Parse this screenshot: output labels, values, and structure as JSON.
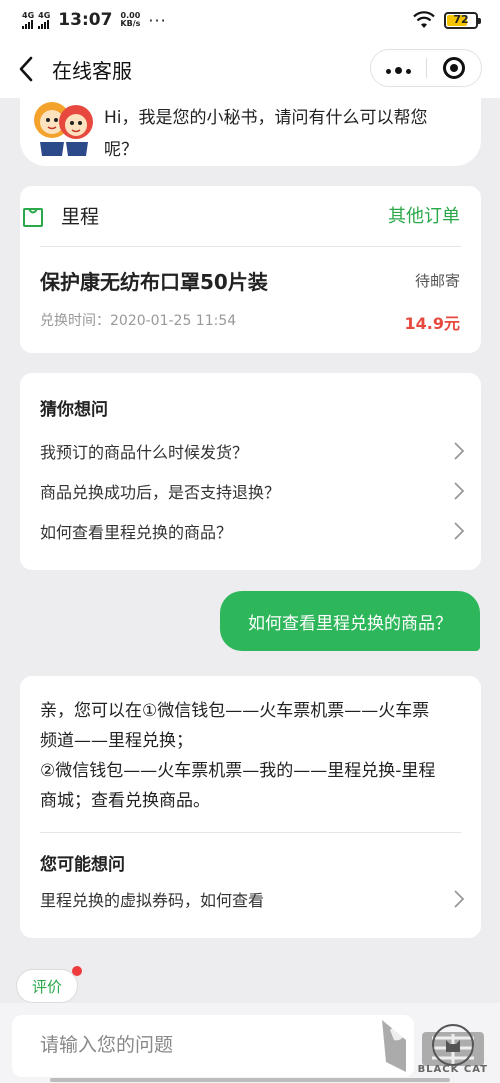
{
  "status_bar": {
    "signal_1": "4G",
    "signal_2": "4G",
    "time": "13:07",
    "net_speed_value": "0.00",
    "net_speed_unit": "KB/s",
    "dots": "···",
    "battery_level": "72",
    "battery_color": "#f5c400"
  },
  "nav": {
    "title": "在线客服",
    "icons": [
      "back-icon",
      "more-icon",
      "target-icon"
    ]
  },
  "bot_greeting": {
    "text": "Hi，我是您的小秘书，请问有什么可以帮您呢？"
  },
  "order_card": {
    "brand": "里程",
    "other_orders": "其他订单",
    "product": "保护康无纺布口罩50片装",
    "status": "待邮寄",
    "redeem_time": "兑换时间：2020-01-25 11:54",
    "price": "14.9元"
  },
  "faq": {
    "title": "猜你想问",
    "items": [
      "我预订的商品什么时候发货？",
      "商品兑换成功后，是否支持退换？",
      "如何查看里程兑换的商品？"
    ]
  },
  "user_message": "如何查看里程兑换的商品？",
  "answer": {
    "lines": [
      "亲，您可以在①微信钱包——火车票机票——火车票",
      "频道——里程兑换；",
      "②微信钱包——火车票机票—我的——里程兑换-里程",
      "商城；查看兑换商品。"
    ],
    "related_title": "您可能想问",
    "related_items": [
      "里程兑换的虚拟券码，如何查看"
    ]
  },
  "rate_label": "评价",
  "input": {
    "placeholder": "请输入您的问题"
  },
  "watermark": "BLACK CAT",
  "colors": {
    "accent_green": "#2eb65a",
    "price_red": "#e8493f"
  }
}
